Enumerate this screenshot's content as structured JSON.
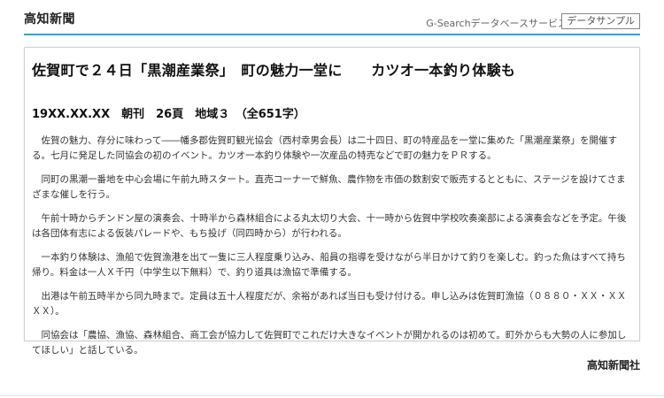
{
  "header": {
    "brand": "高知新聞",
    "service": "G-Searchデータベースサービス",
    "sample_button": "データサンプル"
  },
  "article": {
    "headline": "佐賀町で２４日「黒潮産業祭」　町の魅力一堂に　　カツオ一本釣り体験も",
    "meta": "19XX.XX.XX　朝刊　26頁　地域３　（全651字）",
    "paragraphs": [
      "佐賀の魅力、存分に味わって――幡多郡佐賀町観光協会（西村幸男会長）は二十四日、町の特産品を一堂に集めた「黒潮産業祭」を開催する。七月に発足した同協会の初のイベント。カツオ一本釣り体験や一次産品の特売などで町の魅力をＰＲする。",
      "同町の黒潮一番地を中心会場に午前九時スタート。直売コーナーで鮮魚、農作物を市価の数割安で販売するとともに、ステージを設けてさまざまな催しを行う。",
      "午前十時からチンドン屋の演奏会、十時半から森林組合による丸太切り大会、十一時から佐賀中学校吹奏楽部による演奏会などを予定。午後は各団体有志による仮装パレードや、もち投げ（同四時から）が行われる。",
      "一本釣り体験は、漁船で佐賀漁港を出て一隻に三人程度乗り込み、船員の指導を受けながら半日かけて釣りを楽しむ。釣った魚はすべて持ち帰り。料金は一人Ｘ千円（中学生以下無料）で、釣り道具は漁協で準備する。",
      "出港は午前五時半から同九時まで。定員は五十人程度だが、余裕があれば当日も受け付ける。申し込みは佐賀町漁協（０８８０・ＸＸ・ＸＸＸＸ）。",
      "同協会は「農協、漁協、森林組合、商工会が協力して佐賀町でこれだけ大きなイベントが開かれるのは初めて。町外からも大勢の人に参加してほしい」と話している。"
    ]
  },
  "footer": {
    "publisher": "高知新聞社"
  },
  "colors": {
    "accent": "#2aa3e0"
  }
}
